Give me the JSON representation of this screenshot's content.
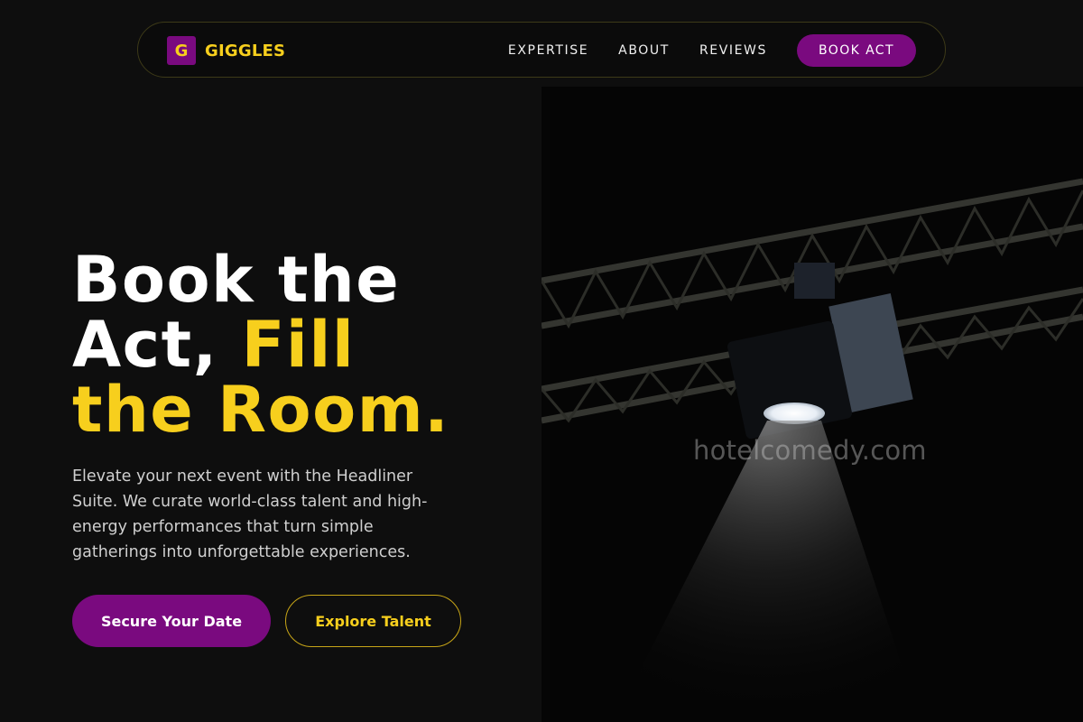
{
  "brand": {
    "mark": "G",
    "name": "GIGGLES"
  },
  "nav": {
    "links": [
      "EXPERTISE",
      "ABOUT",
      "REVIEWS"
    ],
    "cta": "BOOK ACT"
  },
  "hero": {
    "title_line1": "Book the",
    "title_line2_plain": "Act, ",
    "title_line2_accent": "Fill",
    "title_line3_accent": "the Room.",
    "description": "Elevate your next event with the Headliner Suite. We curate world-class talent and high-energy performances that turn simple gatherings into unforgettable experiences.",
    "primary_button": "Secure Your Date",
    "secondary_button": "Explore Talent"
  },
  "image": {
    "subject": "stage spotlight on truss",
    "watermark": "hotelcomedy.com"
  },
  "colors": {
    "background": "#0e0e0e",
    "accent_yellow": "#f7cf1d",
    "accent_purple": "#7a0a7f"
  }
}
